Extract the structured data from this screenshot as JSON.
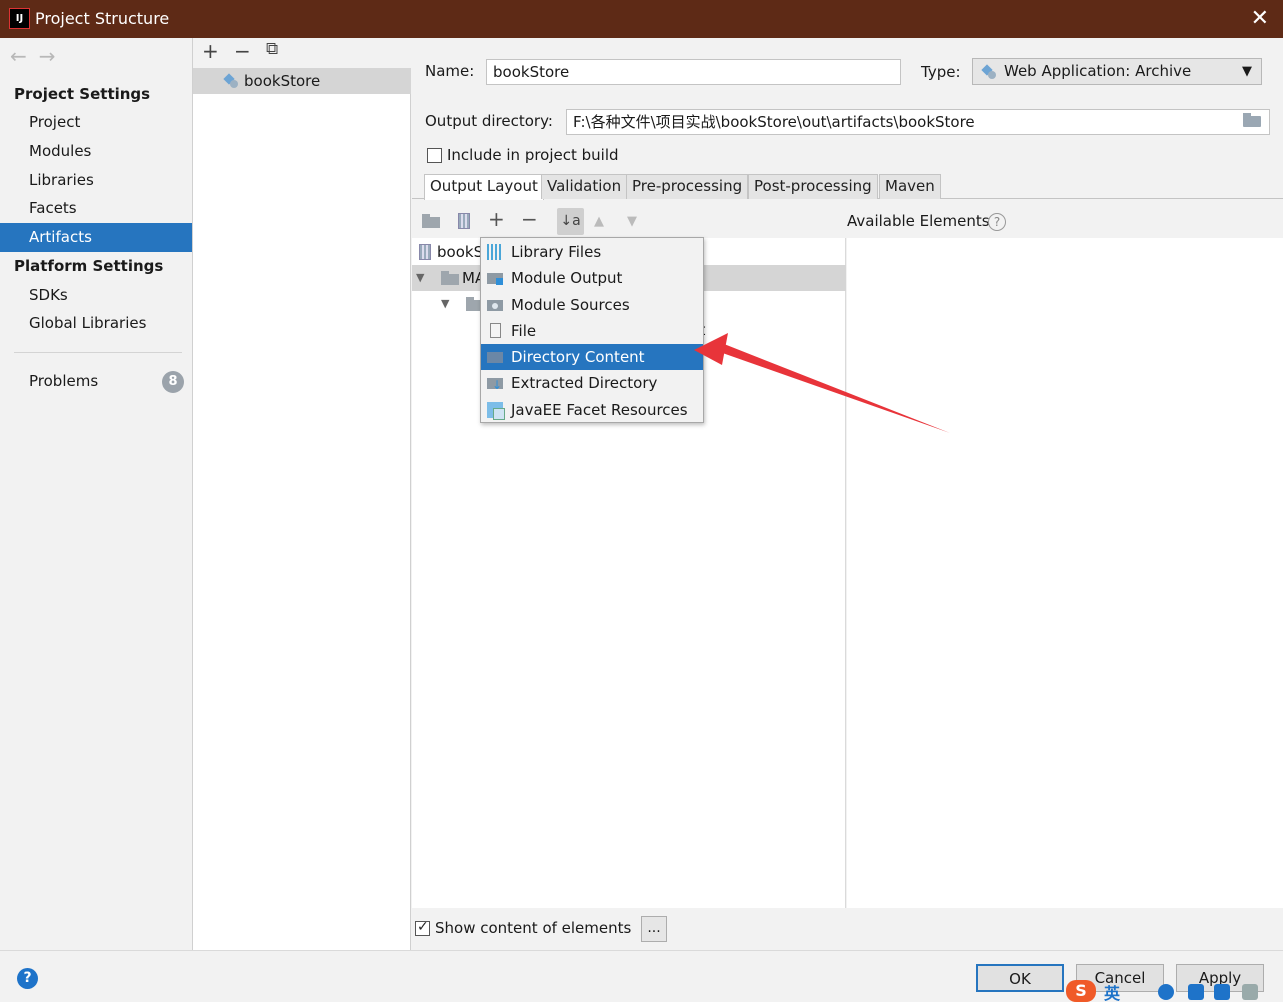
{
  "window": {
    "title": "Project Structure",
    "app_icon_text": "IJ",
    "close_glyph": "✕"
  },
  "sidebar": {
    "back_arrow": "←",
    "forward_arrow": "→",
    "project_settings_header": "Project Settings",
    "project_items": [
      "Project",
      "Modules",
      "Libraries",
      "Facets",
      "Artifacts"
    ],
    "selected_item": "Artifacts",
    "platform_settings_header": "Platform Settings",
    "platform_items": [
      "SDKs",
      "Global Libraries"
    ],
    "problems_label": "Problems",
    "problems_count": "8"
  },
  "artifact_list": {
    "add_glyph": "+",
    "remove_glyph": "−",
    "copy_glyph": "⧉",
    "items": [
      "bookStore"
    ]
  },
  "artifact": {
    "name_label": "Name:",
    "name_value": "bookStore",
    "type_label": "Type:",
    "type_value": "Web Application: Archive",
    "output_dir_label": "Output directory:",
    "output_dir_value": "F:\\各种文件\\项目实战\\bookStore\\out\\artifacts\\bookStore",
    "include_in_build_label": "Include in project build",
    "include_in_build_checked": false
  },
  "tabs": [
    "Output Layout",
    "Validation",
    "Pre-processing",
    "Post-processing",
    "Maven"
  ],
  "active_tab": "Output Layout",
  "layout_toolbar": {
    "add_glyph": "+",
    "remove_glyph": "−",
    "sort_glyph": "↓a z",
    "up_glyph": "▲",
    "down_glyph": "▼"
  },
  "tree": {
    "root_label_visible": "bookS",
    "row2_label_visible": "MA",
    "row4_tail_visible": "ut"
  },
  "available_elements": {
    "label": "Available Elements",
    "help_glyph": "?"
  },
  "popup_menu": {
    "items": [
      "Library Files",
      "Module Output",
      "Module Sources",
      "File",
      "Directory Content",
      "Extracted Directory",
      "JavaEE Facet Resources"
    ],
    "highlighted": "Directory Content"
  },
  "bottom": {
    "show_content_label": "Show content of elements",
    "show_content_checked": true,
    "ellipsis_label": "..."
  },
  "footer": {
    "help_glyph": "?",
    "ok_label": "OK",
    "cancel_label": "Cancel",
    "apply_label": "Apply"
  },
  "ime": {
    "logo": "S",
    "mode": "英"
  },
  "colors": {
    "titlebar": "#5e2a16",
    "selection": "#2675bf",
    "annotation_arrow": "#e8343a"
  }
}
